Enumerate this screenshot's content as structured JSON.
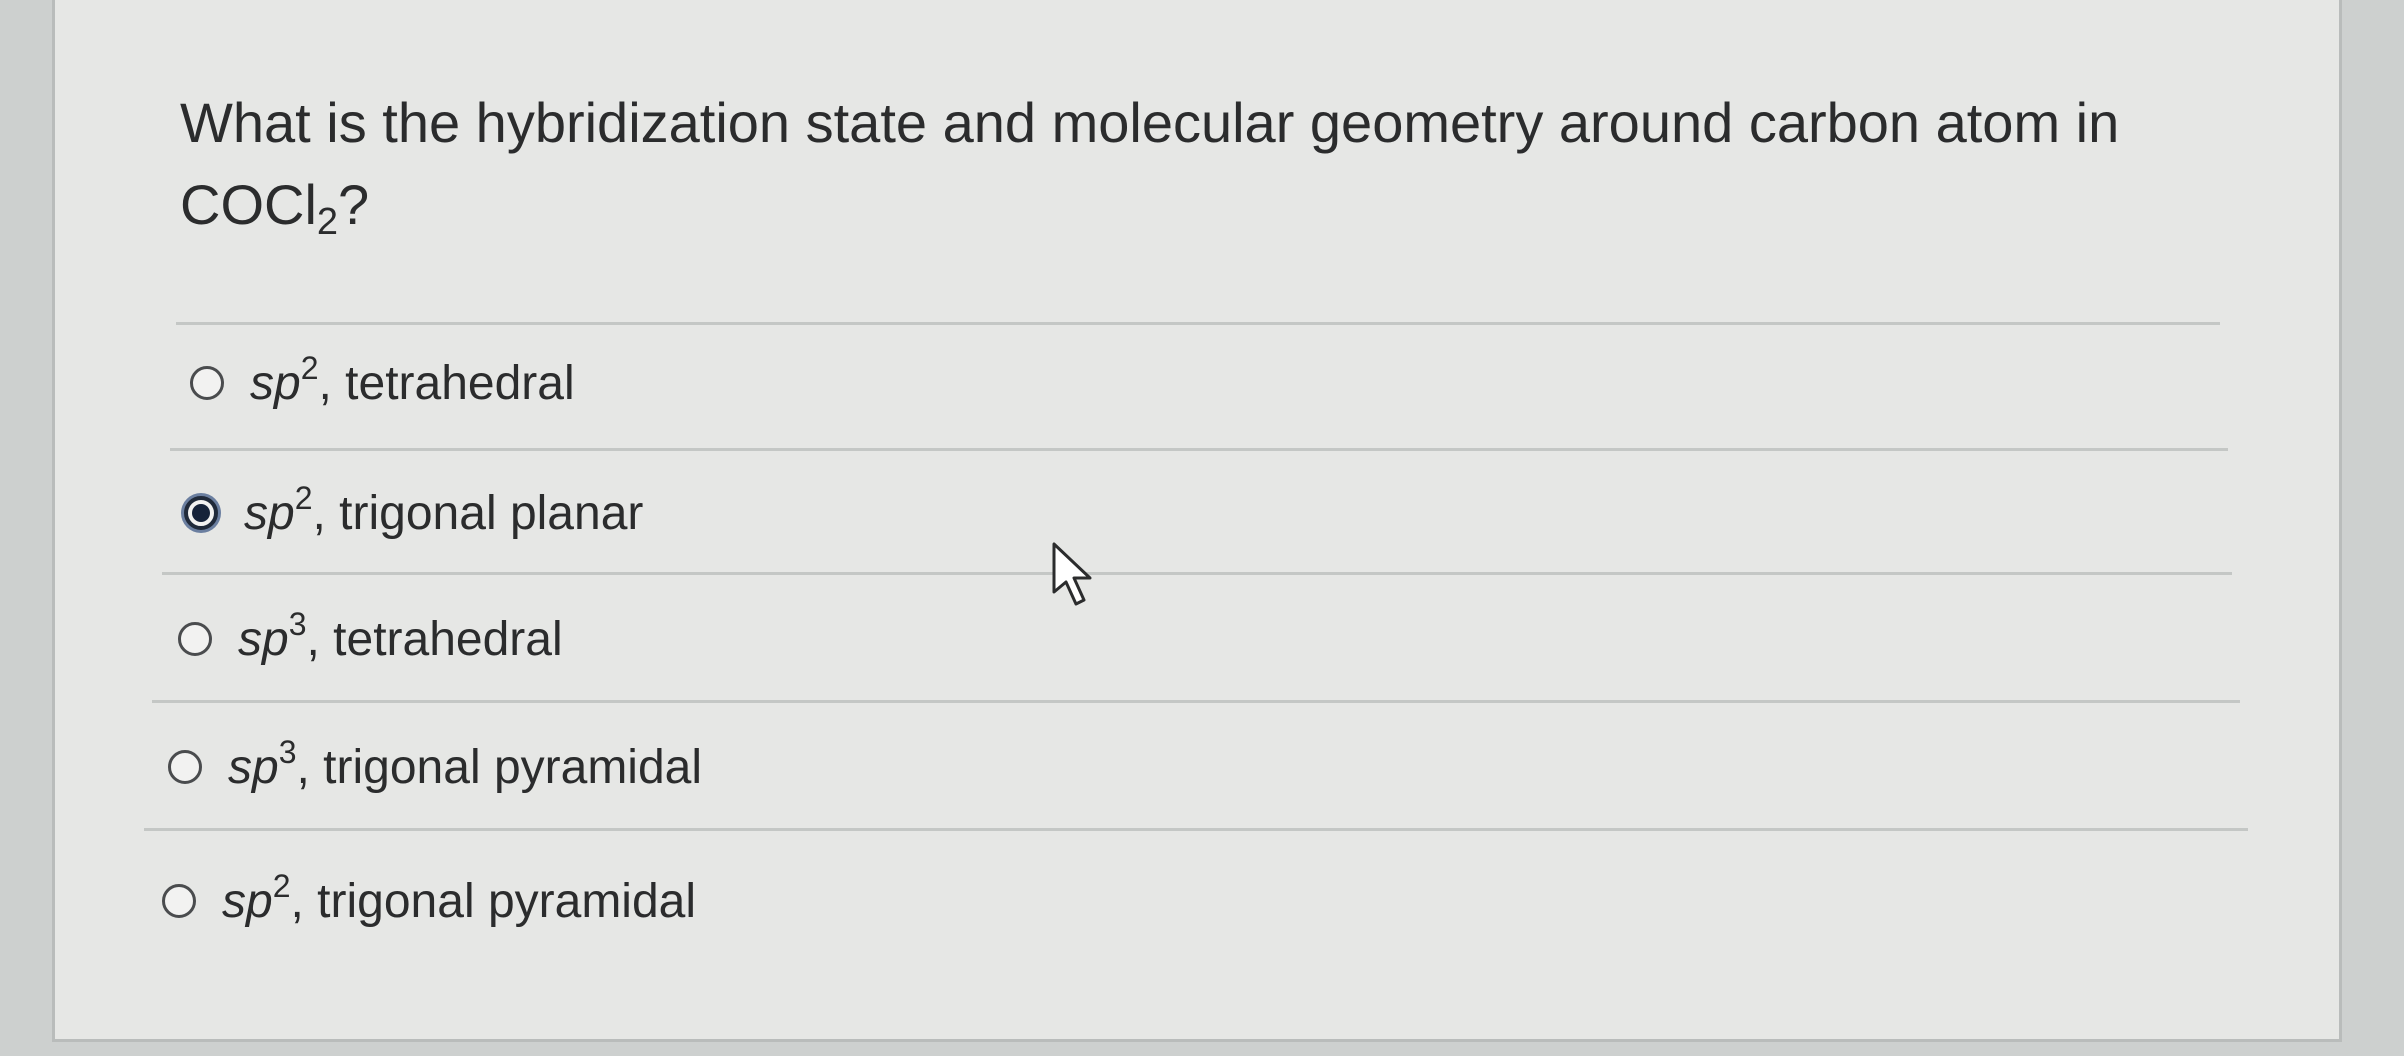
{
  "question": {
    "text_before": "What is the hybridization state and molecular geometry around carbon atom in",
    "formula_main": "COCl",
    "formula_sub": "2",
    "formula_end": "?"
  },
  "options": [
    {
      "hyb": "sp",
      "exp": "2",
      "rest": ", tetrahedral",
      "selected": false
    },
    {
      "hyb": "sp",
      "exp": "2",
      "rest": ", trigonal planar",
      "selected": true
    },
    {
      "hyb": "sp",
      "exp": "3",
      "rest": ", tetrahedral",
      "selected": false
    },
    {
      "hyb": "sp",
      "exp": "3",
      "rest": ", trigonal pyramidal",
      "selected": false
    },
    {
      "hyb": "sp",
      "exp": "2",
      "rest": ", trigonal pyramidal",
      "selected": false
    }
  ],
  "icons": {
    "cursor": "arrow-pointer-icon"
  }
}
